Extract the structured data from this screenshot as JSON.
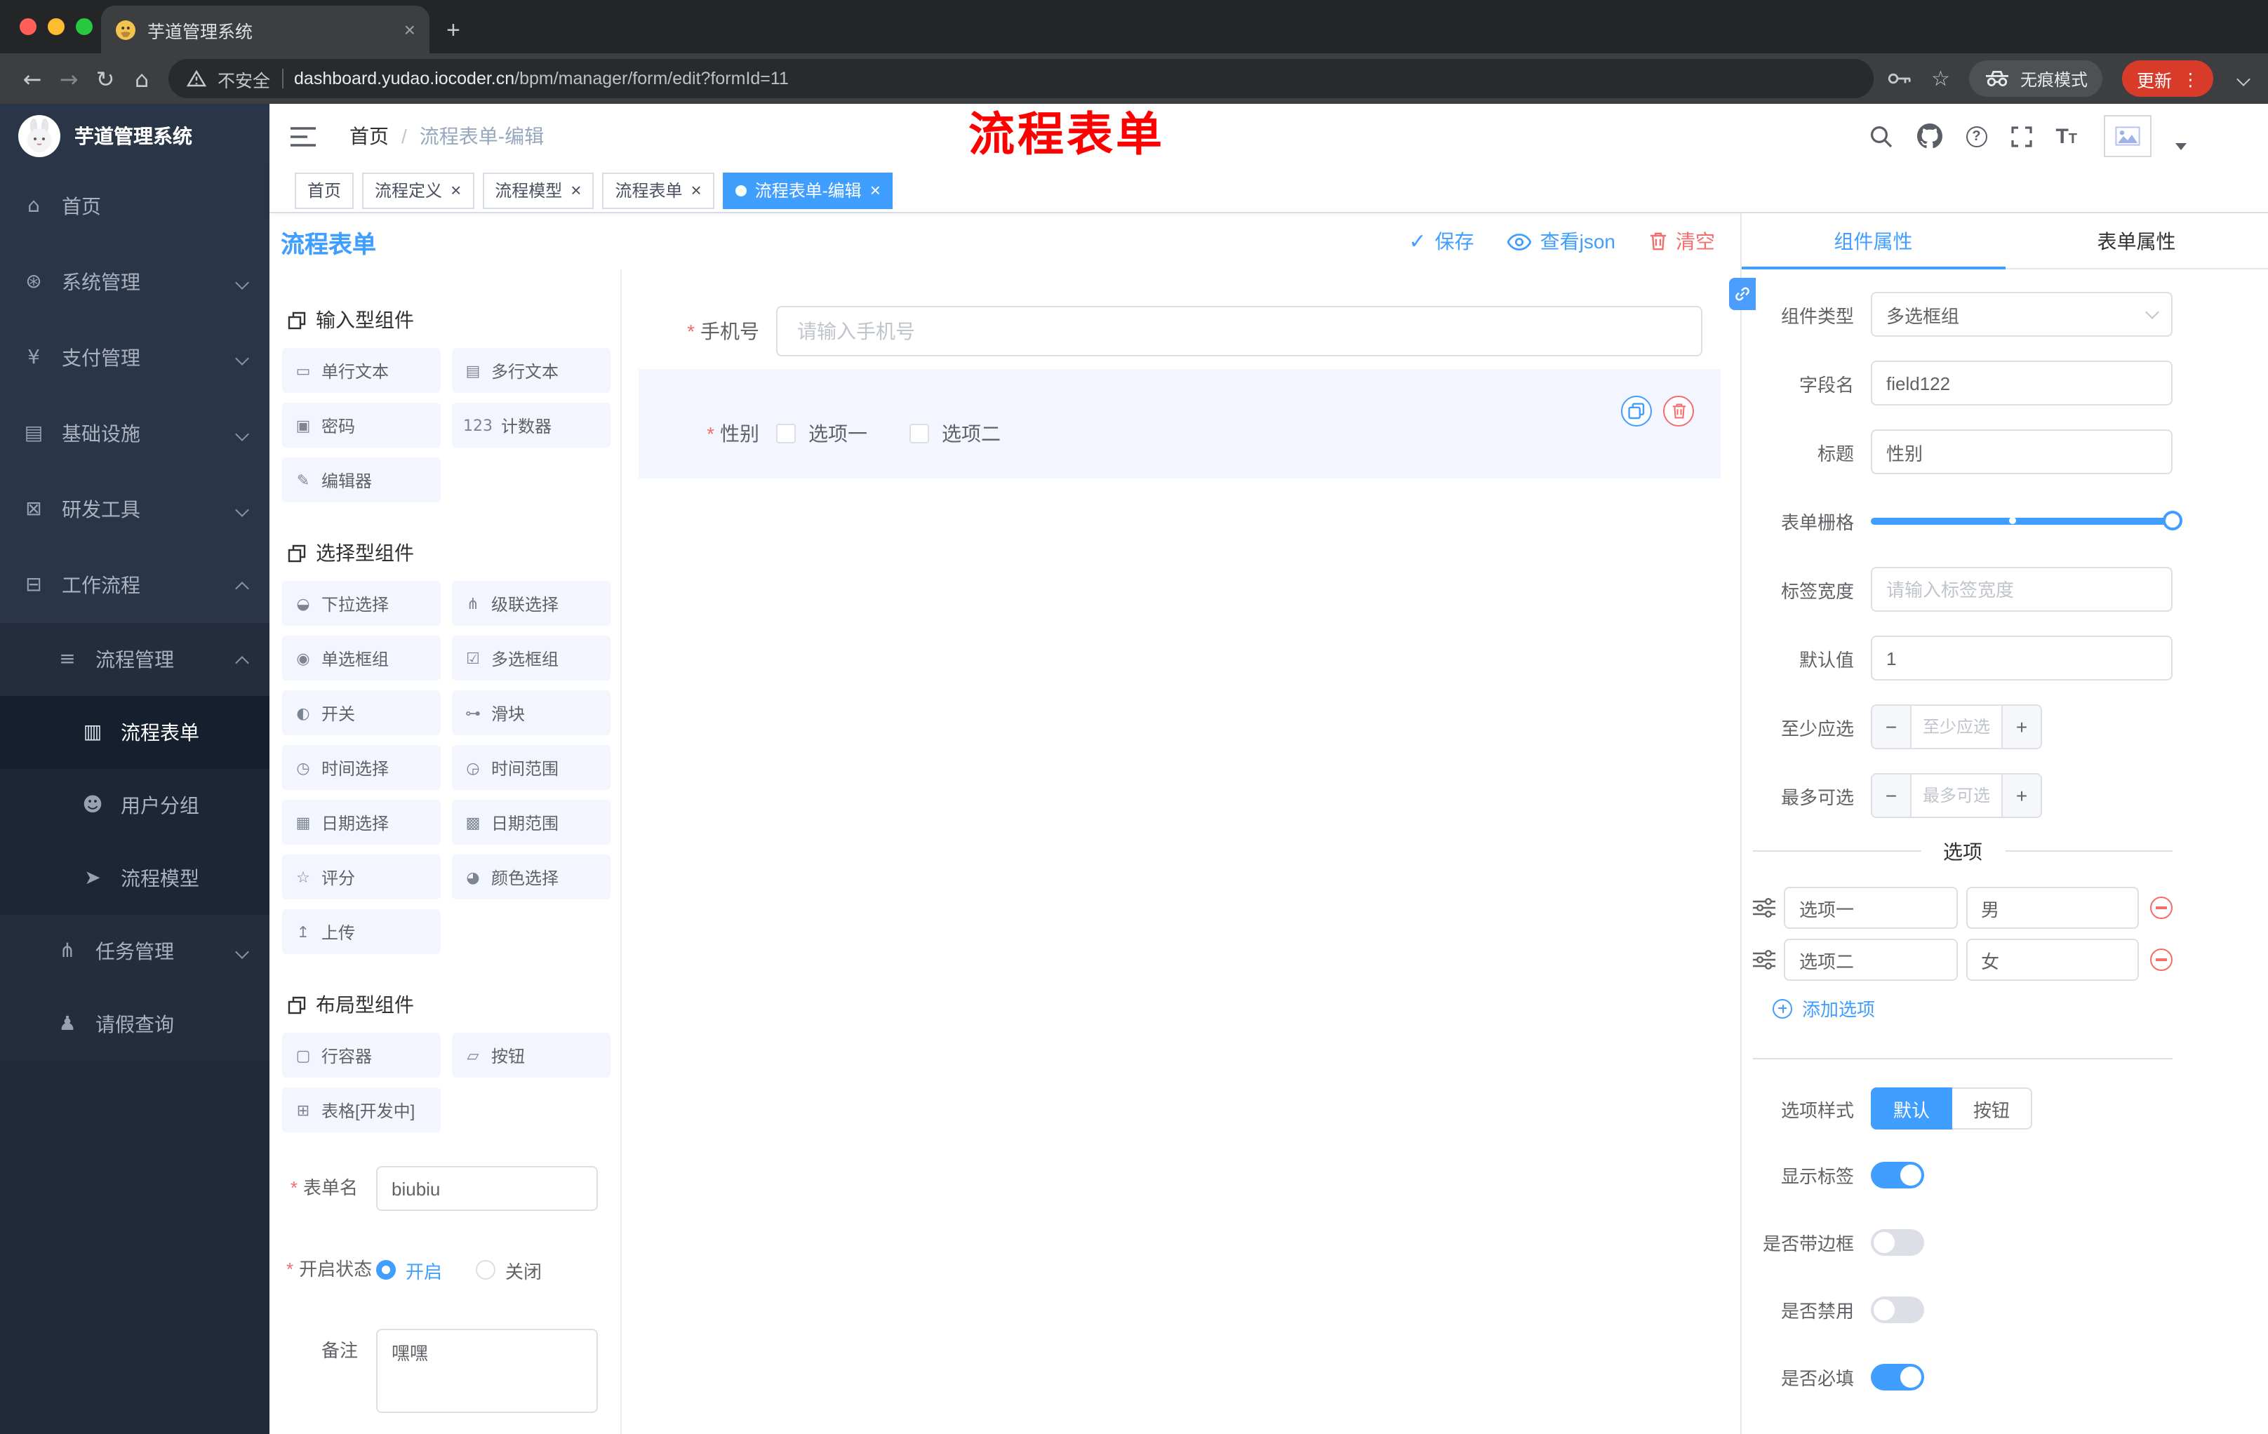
{
  "theme": {
    "primary": "#409eff",
    "danger": "#f56c6c",
    "annotation": "#fe0000",
    "sidebar_bg": "#2a3548",
    "update": "#d93b2b"
  },
  "browser": {
    "tab_title": "芋道管理系统",
    "security_label": "不安全",
    "url_domain": "dashboard.yudao.iocoder.cn",
    "url_path": "/bpm/manager/form/edit?formId=11",
    "incognito_label": "无痕模式",
    "update_label": "更新"
  },
  "sidebar": {
    "title": "芋道管理系统",
    "items": [
      {
        "name": "sidebar-item-home",
        "icon": "dashboard-icon",
        "glyph": "⌂",
        "label": "首页"
      },
      {
        "name": "sidebar-item-system",
        "icon": "gear-icon",
        "glyph": "⊛",
        "label": "系统管理",
        "expandable": true
      },
      {
        "name": "sidebar-item-payment",
        "icon": "yen-icon",
        "glyph": "¥",
        "label": "支付管理",
        "expandable": true
      },
      {
        "name": "sidebar-item-infrastructure",
        "icon": "monitor-icon",
        "glyph": "▤",
        "label": "基础设施",
        "expandable": true
      },
      {
        "name": "sidebar-item-devtools",
        "icon": "toolbox-icon",
        "glyph": "⊠",
        "label": "研发工具",
        "expandable": true
      },
      {
        "name": "sidebar-item-workflow",
        "icon": "briefcase-icon",
        "glyph": "⊟",
        "label": "工作流程",
        "expandable": true,
        "open": true
      },
      {
        "name": "sidebar-item-process-management",
        "icon": "list-icon",
        "glyph": "≡",
        "label": "流程管理",
        "lv2": true,
        "expandable": true,
        "open": true
      },
      {
        "name": "sidebar-item-process-form",
        "icon": "document-icon",
        "glyph": "▥",
        "label": "流程表单",
        "lv3": true,
        "active": true
      },
      {
        "name": "sidebar-item-user-group",
        "icon": "users-icon",
        "glyph": "☻",
        "label": "用户分组",
        "lv3": true
      },
      {
        "name": "sidebar-item-process-model",
        "icon": "send-icon",
        "glyph": "➤",
        "label": "流程模型",
        "lv3": true
      },
      {
        "name": "sidebar-item-task-management",
        "icon": "tree-icon",
        "glyph": "⋔",
        "label": "任务管理",
        "lv2": true,
        "expandable": true
      },
      {
        "name": "sidebar-item-leave-query",
        "icon": "person-icon",
        "glyph": "♟",
        "label": "请假查询",
        "lv2": true
      }
    ]
  },
  "navbar": {
    "breadcrumb": {
      "home": "首页",
      "current": "流程表单-编辑"
    },
    "annotation": "流程表单"
  },
  "tags": [
    {
      "name": "tag-home",
      "label": "首页"
    },
    {
      "name": "tag-process-definition",
      "label": "流程定义",
      "closable": true
    },
    {
      "name": "tag-process-model",
      "label": "流程模型",
      "closable": true
    },
    {
      "name": "tag-process-form",
      "label": "流程表单",
      "closable": true
    },
    {
      "name": "tag-process-form-edit",
      "label": "流程表单-编辑",
      "closable": true,
      "active": true
    }
  ],
  "designer": {
    "title": "流程表单",
    "save_label": "保存",
    "view_json_label": "查看json",
    "clear_label": "清空",
    "palette_groups": [
      {
        "title": "输入型组件",
        "items": [
          {
            "glyph": "▭",
            "label": "单行文本",
            "icon": "single-line-text-icon"
          },
          {
            "glyph": "▤",
            "label": "多行文本",
            "icon": "multi-line-text-icon"
          },
          {
            "glyph": "▣",
            "label": "密码",
            "icon": "password-icon"
          },
          {
            "glyph": "123",
            "label": "计数器",
            "icon": "counter-icon"
          },
          {
            "glyph": "✎",
            "label": "编辑器",
            "icon": "editor-icon"
          }
        ]
      },
      {
        "title": "选择型组件",
        "items": [
          {
            "glyph": "◒",
            "label": "下拉选择",
            "icon": "select-icon"
          },
          {
            "glyph": "⋔",
            "label": "级联选择",
            "icon": "cascader-icon"
          },
          {
            "glyph": "◉",
            "label": "单选框组",
            "icon": "radio-group-icon"
          },
          {
            "glyph": "☑",
            "label": "多选框组",
            "icon": "checkbox-group-icon"
          },
          {
            "glyph": "◐",
            "label": "开关",
            "icon": "switch-icon"
          },
          {
            "glyph": "⊶",
            "label": "滑块",
            "icon": "slider-icon"
          },
          {
            "glyph": "◷",
            "label": "时间选择",
            "icon": "time-picker-icon"
          },
          {
            "glyph": "◶",
            "label": "时间范围",
            "icon": "time-range-icon"
          },
          {
            "glyph": "▦",
            "label": "日期选择",
            "icon": "date-picker-icon"
          },
          {
            "glyph": "▩",
            "label": "日期范围",
            "icon": "date-range-icon"
          },
          {
            "glyph": "☆",
            "label": "评分",
            "icon": "rate-icon"
          },
          {
            "glyph": "◕",
            "label": "颜色选择",
            "icon": "color-picker-icon"
          },
          {
            "glyph": "↥",
            "label": "上传",
            "icon": "upload-icon"
          }
        ]
      },
      {
        "title": "布局型组件",
        "items": [
          {
            "glyph": "▢",
            "label": "行容器",
            "icon": "row-container-icon"
          },
          {
            "glyph": "▱",
            "label": "按钮",
            "icon": "button-icon"
          },
          {
            "glyph": "⊞",
            "label": "表格[开发中]",
            "icon": "table-icon"
          }
        ]
      }
    ],
    "palette_form": {
      "name_label": "表单名",
      "name_value": "biubiu",
      "status_label": "开启状态",
      "status_options": [
        {
          "name": "status-radio-on",
          "label": "开启",
          "selected": true
        },
        {
          "name": "status-radio-off",
          "label": "关闭"
        }
      ],
      "remark_label": "备注",
      "remark_value": "嘿嘿"
    },
    "canvas": {
      "phone": {
        "label": "手机号",
        "placeholder": "请输入手机号"
      },
      "gender": {
        "label": "性别",
        "options": [
          "选项一",
          "选项二"
        ]
      }
    },
    "props": {
      "tab_component": "组件属性",
      "tab_form": "表单属性",
      "component_type_label": "组件类型",
      "component_type_value": "多选框组",
      "field_name_label": "字段名",
      "field_name_value": "field122",
      "title_label": "标题",
      "title_value": "性别",
      "grid_label": "表单栅格",
      "label_width_label": "标签宽度",
      "label_width_placeholder": "请输入标签宽度",
      "default_label": "默认值",
      "default_value": "1",
      "min_label": "至少应选",
      "min_placeholder": "至少应选",
      "max_label": "最多可选",
      "max_placeholder": "最多可选",
      "options_title": "选项",
      "options": [
        {
          "label": "选项一",
          "value": "男"
        },
        {
          "label": "选项二",
          "value": "女"
        }
      ],
      "add_option_label": "添加选项",
      "option_style_label": "选项样式",
      "option_style_default": "默认",
      "option_style_button": "按钮",
      "toggles": [
        {
          "name": "show-label-toggle",
          "label": "显示标签",
          "on": true
        },
        {
          "name": "border-toggle",
          "label": "是否带边框",
          "on": false
        },
        {
          "name": "disabled-toggle",
          "label": "是否禁用",
          "on": false
        },
        {
          "name": "required-toggle",
          "label": "是否必填",
          "on": true
        }
      ]
    }
  }
}
